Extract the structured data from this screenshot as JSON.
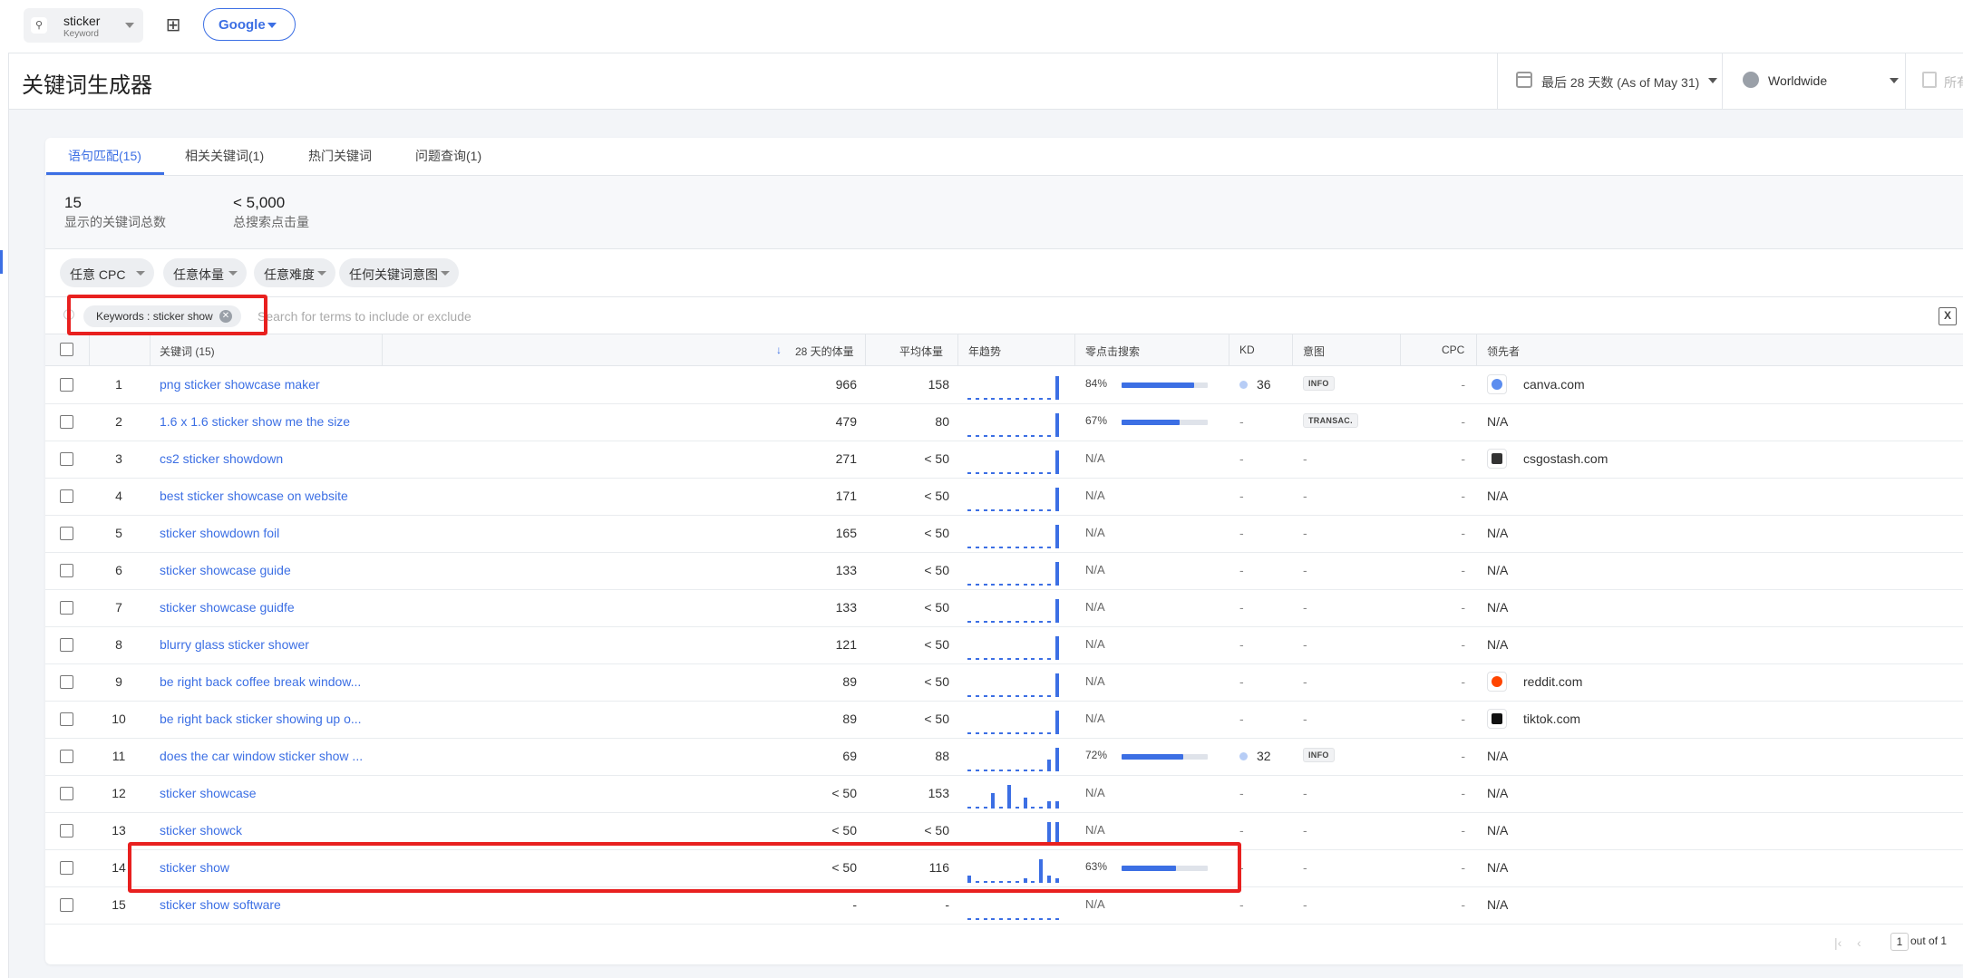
{
  "topbar": {
    "search_keyword": "sticker",
    "search_sublabel": "Keyword",
    "engine_label": "Google"
  },
  "header": {
    "title": "关键词生成器",
    "date_range": "最后 28 天数 (As of May 31)",
    "location": "Worldwide",
    "device_label": "所有"
  },
  "tabs": [
    {
      "label": "语句匹配(15)"
    },
    {
      "label": "相关关键词(1)"
    },
    {
      "label": "热门关键词"
    },
    {
      "label": "问题查询(1)"
    }
  ],
  "summary": {
    "total_keywords_value": "15",
    "total_keywords_label": "显示的关键词总数",
    "total_clicks_value": "< 5,000",
    "total_clicks_label": "总搜索点击量"
  },
  "filters": [
    "任意 CPC",
    "任意体量",
    "任意难度",
    "任何关键词意图"
  ],
  "search": {
    "chip_label": "Keywords : sticker show",
    "placeholder": "Search for terms to include or exclude"
  },
  "columns": {
    "keyword": "关键词 (15)",
    "volume28": "28 天的体量",
    "avg_volume": "平均体量",
    "trend": "年趋势",
    "zero_click": "零点击搜索",
    "kd": "KD",
    "intent": "意图",
    "cpc": "CPC",
    "leader": "领先者"
  },
  "rows": [
    {
      "n": "1",
      "keyword": "png sticker showcase maker",
      "vol": "966",
      "avg": "158",
      "zc": "84%",
      "zc_value": 84,
      "kd": "36",
      "intent": "INFO",
      "cpc": "-",
      "leader": "canva.com",
      "leader_icon": "canva",
      "trend": [
        0,
        0,
        0,
        0,
        0,
        0,
        0,
        0,
        0,
        0,
        0,
        1
      ]
    },
    {
      "n": "2",
      "keyword": "1.6 x 1.6 sticker show me the size",
      "vol": "479",
      "avg": "80",
      "zc": "67%",
      "zc_value": 67,
      "kd": "-",
      "intent": "TRANSAC.",
      "cpc": "-",
      "leader": "N/A",
      "leader_icon": "",
      "trend": [
        0,
        0,
        0,
        0,
        0,
        0,
        0,
        0,
        0,
        0,
        0,
        1
      ]
    },
    {
      "n": "3",
      "keyword": "cs2 sticker showdown",
      "vol": "271",
      "avg": "< 50",
      "zc": "N/A",
      "zc_value": null,
      "kd": "-",
      "intent": "-",
      "cpc": "-",
      "leader": "csgostash.com",
      "leader_icon": "csgostash",
      "trend": [
        0,
        0,
        0,
        0,
        0,
        0,
        0,
        0,
        0,
        0,
        0,
        1
      ]
    },
    {
      "n": "4",
      "keyword": "best sticker showcase on website",
      "vol": "171",
      "avg": "< 50",
      "zc": "N/A",
      "zc_value": null,
      "kd": "-",
      "intent": "-",
      "cpc": "-",
      "leader": "N/A",
      "leader_icon": "",
      "trend": [
        0,
        0,
        0,
        0,
        0,
        0,
        0,
        0,
        0,
        0,
        0,
        1
      ]
    },
    {
      "n": "5",
      "keyword": "sticker showdown foil",
      "vol": "165",
      "avg": "< 50",
      "zc": "N/A",
      "zc_value": null,
      "kd": "-",
      "intent": "-",
      "cpc": "-",
      "leader": "N/A",
      "leader_icon": "",
      "trend": [
        0,
        0,
        0,
        0,
        0,
        0,
        0,
        0,
        0,
        0,
        0,
        1
      ]
    },
    {
      "n": "6",
      "keyword": "sticker showcase guide",
      "vol": "133",
      "avg": "< 50",
      "zc": "N/A",
      "zc_value": null,
      "kd": "-",
      "intent": "-",
      "cpc": "-",
      "leader": "N/A",
      "leader_icon": "",
      "trend": [
        0,
        0,
        0,
        0,
        0,
        0,
        0,
        0,
        0,
        0,
        0,
        1
      ]
    },
    {
      "n": "7",
      "keyword": "sticker showcase guidfe",
      "vol": "133",
      "avg": "< 50",
      "zc": "N/A",
      "zc_value": null,
      "kd": "-",
      "intent": "-",
      "cpc": "-",
      "leader": "N/A",
      "leader_icon": "",
      "trend": [
        0,
        0,
        0,
        0,
        0,
        0,
        0,
        0,
        0,
        0,
        0,
        1
      ]
    },
    {
      "n": "8",
      "keyword": "blurry glass sticker shower",
      "vol": "121",
      "avg": "< 50",
      "zc": "N/A",
      "zc_value": null,
      "kd": "-",
      "intent": "-",
      "cpc": "-",
      "leader": "N/A",
      "leader_icon": "",
      "trend": [
        0,
        0,
        0,
        0,
        0,
        0,
        0,
        0,
        0,
        0,
        0,
        1
      ]
    },
    {
      "n": "9",
      "keyword": "be right back coffee break window...",
      "vol": "89",
      "avg": "< 50",
      "zc": "N/A",
      "zc_value": null,
      "kd": "-",
      "intent": "-",
      "cpc": "-",
      "leader": "reddit.com",
      "leader_icon": "reddit",
      "trend": [
        0,
        0,
        0,
        0,
        0,
        0,
        0,
        0,
        0,
        0,
        0,
        1
      ]
    },
    {
      "n": "10",
      "keyword": "be right back sticker showing up o...",
      "vol": "89",
      "avg": "< 50",
      "zc": "N/A",
      "zc_value": null,
      "kd": "-",
      "intent": "-",
      "cpc": "-",
      "leader": "tiktok.com",
      "leader_icon": "tiktok",
      "trend": [
        0,
        0,
        0,
        0,
        0,
        0,
        0,
        0,
        0,
        0,
        0,
        1
      ]
    },
    {
      "n": "11",
      "keyword": "does the car window sticker show ...",
      "vol": "69",
      "avg": "88",
      "zc": "72%",
      "zc_value": 72,
      "kd": "32",
      "intent": "INFO",
      "cpc": "-",
      "leader": "N/A",
      "leader_icon": "",
      "trend": [
        0,
        0,
        0,
        0,
        0,
        0,
        0,
        0,
        0,
        0,
        0.5,
        1
      ]
    },
    {
      "n": "12",
      "keyword": "sticker showcase",
      "vol": "< 50",
      "avg": "153",
      "zc": "N/A",
      "zc_value": null,
      "kd": "-",
      "intent": "-",
      "cpc": "-",
      "leader": "N/A",
      "leader_icon": "",
      "trend": [
        0,
        0,
        0,
        0.65,
        0,
        1,
        0,
        0.45,
        0,
        0,
        0.3,
        0.3
      ]
    },
    {
      "n": "13",
      "keyword": "sticker showck",
      "vol": "< 50",
      "avg": "< 50",
      "zc": "N/A",
      "zc_value": null,
      "kd": "-",
      "intent": "-",
      "cpc": "-",
      "leader": "N/A",
      "leader_icon": "",
      "trend": [
        0,
        0,
        0,
        0,
        0,
        0,
        0,
        0,
        0,
        0,
        1,
        1
      ]
    },
    {
      "n": "14",
      "keyword": "sticker show",
      "vol": "< 50",
      "avg": "116",
      "zc": "63%",
      "zc_value": 63,
      "kd": "-",
      "intent": "-",
      "cpc": "-",
      "leader": "N/A",
      "leader_icon": "",
      "trend": [
        0.3,
        0,
        0,
        0,
        0,
        0,
        0,
        0.2,
        0,
        1,
        0.3,
        0.2
      ]
    },
    {
      "n": "15",
      "keyword": "sticker show software",
      "vol": "-",
      "avg": "-",
      "zc": "N/A",
      "zc_value": null,
      "kd": "-",
      "intent": "-",
      "cpc": "-",
      "leader": "N/A",
      "leader_icon": "",
      "trend": [
        0,
        0,
        0,
        0,
        0,
        0,
        0,
        0,
        0,
        0,
        0,
        0
      ]
    }
  ],
  "pagination": {
    "page": "1",
    "of_label": "out of 1"
  },
  "colors": {
    "accent": "#3c6fe4",
    "highlight": "#e8201f"
  }
}
